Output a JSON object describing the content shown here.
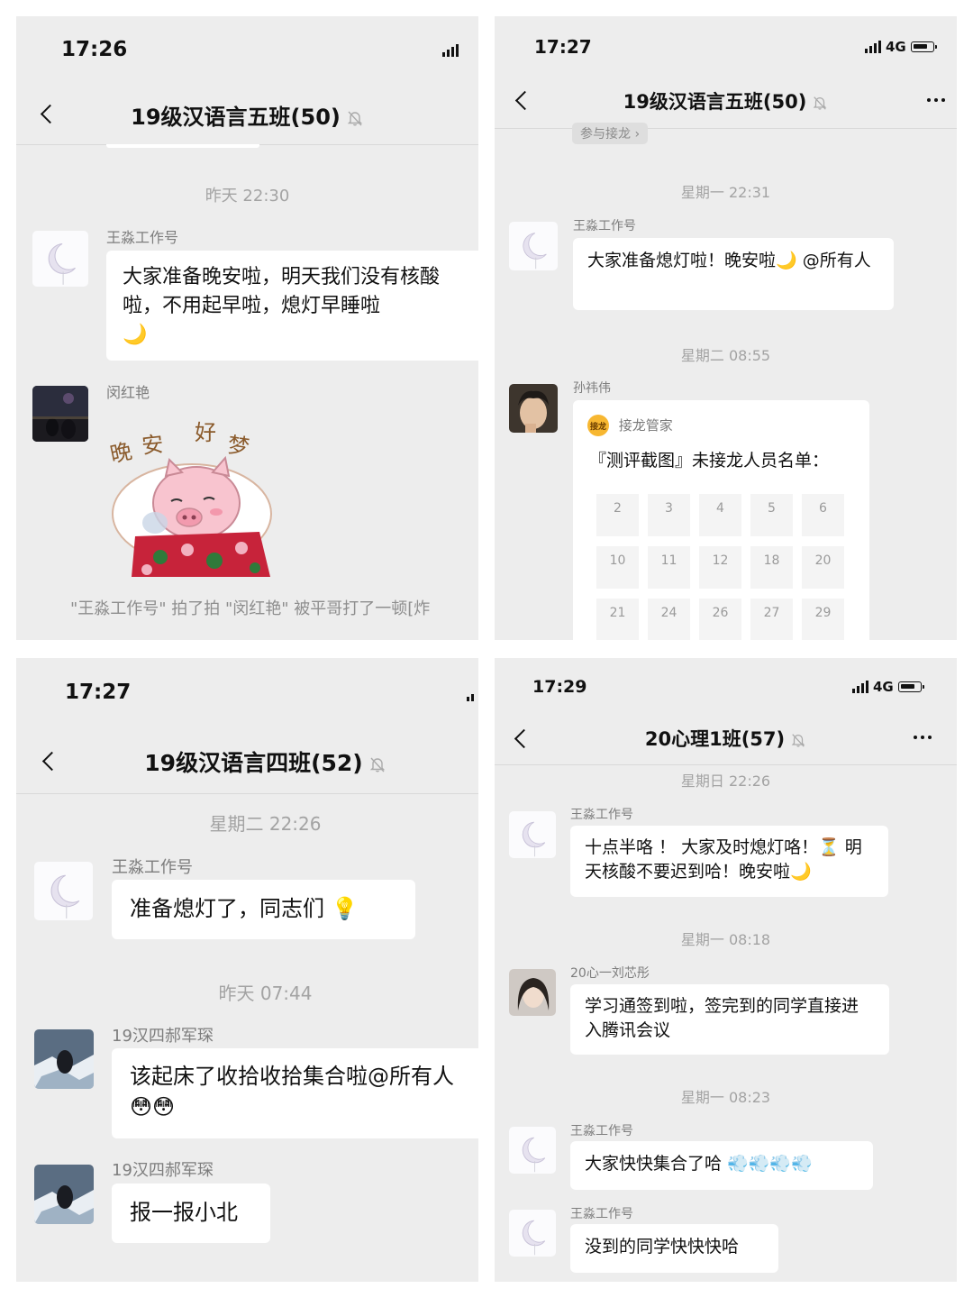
{
  "panels": {
    "p1": {
      "time": "17:26",
      "title": "19级汉语言五班(50)",
      "messages": {
        "stamp1": "昨天 22:30",
        "m1_sender": "王淼工作号",
        "m1_text": "大家准备晚安啦，明天我们没有核酸啦，不用起早啦，熄灯早睡啦",
        "m1_emoji": "🌙",
        "m2_sender": "闵红艳",
        "sticker_text": [
          "晚",
          "安",
          "好",
          "梦"
        ],
        "system_text": "\"王淼工作号\" 拍了拍 \"闵红艳\" 被平哥打了一顿[炸"
      }
    },
    "p2": {
      "time": "17:27",
      "network": "4G",
      "title": "19级汉语言五班(50)",
      "join_pill": "参与接龙 ›",
      "messages": {
        "stamp1": "星期一 22:31",
        "m1_sender": "王淼工作号",
        "m1_text": "大家准备熄灯啦！晚安啦🌙 @所有人",
        "stamp2": "星期二 08:55",
        "m2_sender": "孙祎伟",
        "card_badge": "接龙",
        "card_source": "接龙管家",
        "card_title": "『测评截图』未接龙人员名单：",
        "card_numbers": [
          "2",
          "3",
          "4",
          "5",
          "6",
          "10",
          "11",
          "12",
          "18",
          "20",
          "21",
          "24",
          "26",
          "27",
          "29"
        ]
      }
    },
    "p3": {
      "time": "17:27",
      "title": "19级汉语言四班(52)",
      "messages": {
        "stamp1": "星期二 22:26",
        "m1_sender": "王淼工作号",
        "m1_text": "准备熄灯了，同志们 💡",
        "stamp2": "昨天 07:44",
        "m2_sender": "19汉四郝军琛",
        "m2_text": "该起床了收拾收拾集合啦@所有人",
        "m2_emoji": "😳😳",
        "m3_sender": "19汉四郝军琛",
        "m3_text": "报一报小北"
      }
    },
    "p4": {
      "time": "17:29",
      "network": "4G",
      "title": "20心理1班(57)",
      "messages": {
        "stamp1": "星期日 22:26",
        "m1_sender": "王淼工作号",
        "m1_text": "十点半咯 ！ 大家及时熄灯咯！⏳ 明天核酸不要迟到哈！晚安啦🌙",
        "stamp2": "星期一 08:18",
        "m2_sender": "20心一刘芯彤",
        "m2_text": "学习通签到啦，签完到的同学直接进入腾讯会议",
        "stamp3": "星期一 08:23",
        "m3_sender": "王淼工作号",
        "m3_text": "大家快快集合了哈 💨💨💨💨",
        "m4_sender": "王淼工作号",
        "m4_text": "没到的同学快快快哈"
      }
    }
  },
  "icons": [
    "back-chevron-icon",
    "mute-bell-icon",
    "more-dots-icon",
    "signal-bars-icon",
    "battery-icon",
    "moon-avatar-icon"
  ],
  "colors": {
    "chat_bg": "#ededed",
    "bubble": "#ffffff",
    "timestamp": "#a3a3a3",
    "sender": "#7d7d7d",
    "badge": "#f7b731"
  }
}
